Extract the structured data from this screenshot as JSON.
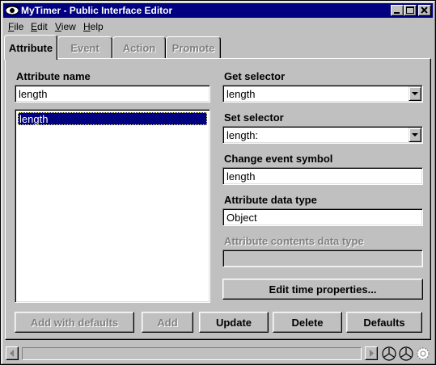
{
  "window": {
    "title": "MyTimer - Public Interface Editor"
  },
  "menu": [
    {
      "key": "F",
      "rest": "ile"
    },
    {
      "key": "E",
      "rest": "dit"
    },
    {
      "key": "V",
      "rest": "iew"
    },
    {
      "key": "H",
      "rest": "elp"
    }
  ],
  "tabs": {
    "attribute": "Attribute",
    "event": "Event",
    "action": "Action",
    "promote": "Promote"
  },
  "attribute_name": {
    "label": "Attribute name",
    "value": "length",
    "list_items": [
      "length"
    ]
  },
  "get_selector": {
    "label": "Get selector",
    "value": "length"
  },
  "set_selector": {
    "label": "Set selector",
    "value": "length:"
  },
  "change_event_symbol": {
    "label": "Change event symbol",
    "value": "length"
  },
  "attribute_data_type": {
    "label": "Attribute data type",
    "value": "Object"
  },
  "attribute_contents_data_type": {
    "label": "Attribute contents data type",
    "value": ""
  },
  "buttons": {
    "edit_time_properties": "Edit time properties...",
    "add_with_defaults": "Add with defaults",
    "add": "Add",
    "update": "Update",
    "delete": "Delete",
    "defaults": "Defaults"
  },
  "colors": {
    "face": "#c0c0c0",
    "titlebar": "#000080",
    "selection": "#000080",
    "disabled_text": "#808080"
  }
}
